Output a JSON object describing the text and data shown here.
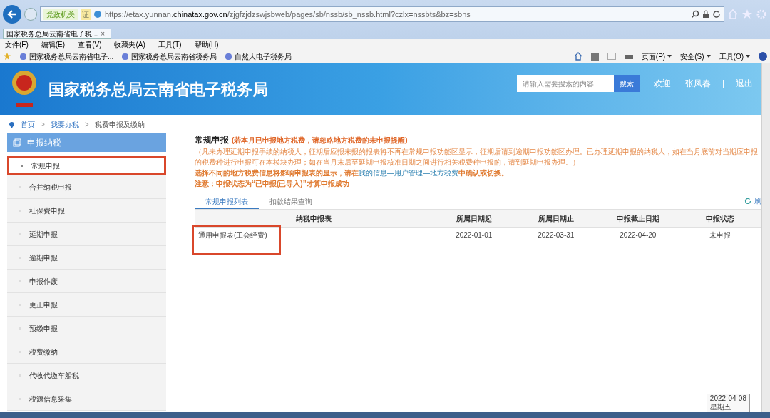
{
  "browser": {
    "address_badge": "党政机关",
    "address_badge_mark": "证",
    "url_host_pre": "https://etax.yunnan.",
    "url_host": "chinatax.gov.cn",
    "url_path": "/zjgfzjdzswjsbweb/pages/sb/nssb/sb_nssb.html?czlx=nssbts&bz=sbns",
    "tab": {
      "title": "国家税务总局云南省电子税...",
      "close": "×"
    },
    "menu": [
      "文件(F)",
      "编辑(E)",
      "查看(V)",
      "收藏夹(A)",
      "工具(T)",
      "帮助(H)"
    ],
    "favorites": [
      "国家税务总局云南省电子...",
      "国家税务总局云南省税务局",
      "自然人电子税务局"
    ],
    "commands": [
      "页面(P)",
      "安全(S)",
      "工具(O)"
    ]
  },
  "header": {
    "site_title": "国家税务总局云南省电子税务局",
    "search": {
      "placeholder": "请输入需要搜索的内容",
      "button": "搜索"
    },
    "welcome": "欢迎",
    "user": "张凤春",
    "separator": "|",
    "logout": "退出"
  },
  "breadcrumb": [
    "首页",
    "我要办税",
    "税费申报及缴纳"
  ],
  "breadcrumb_separator": ">",
  "sidebar": {
    "title": "申报纳税",
    "items": [
      {
        "label": "常规申报",
        "selected": true
      },
      {
        "label": "合并纳税申报",
        "selected": false
      },
      {
        "label": "社保费申报",
        "selected": false
      },
      {
        "label": "延期申报",
        "selected": false
      },
      {
        "label": "逾期申报",
        "selected": false
      },
      {
        "label": "申报作废",
        "selected": false
      },
      {
        "label": "更正申报",
        "selected": false
      },
      {
        "label": "预缴申报",
        "selected": false
      },
      {
        "label": "税费缴纳",
        "selected": false
      },
      {
        "label": "代收代缴车船税",
        "selected": false
      },
      {
        "label": "税源信息采集",
        "selected": false
      }
    ]
  },
  "content": {
    "title": "常规申报",
    "title_note": "(若本月已申报地方税费，请忽略地方税费的未申报提醒)",
    "notice": "（凡未办理延期申报手续的纳税人，征期后应报未报的报表将不再在常规申报功能区显示，征期后请到逾期申报功能区办理。已办理延期申报的纳税人，如在当月底前对当期应申报的税费种进行申报可在本模块办理；如在当月末后至延期申报核准日期之间进行相关税费种申报的，请到延期申报办理。）",
    "hint": {
      "before": "选择不同的地方税费信息将影响申报表的显示，请在",
      "link": "我的信息—用户管理—地方税费",
      "after": "中确认或切换。"
    },
    "warning": "注意：申报状态为“已申报(已导入)”才算申报成功",
    "tabs": [
      {
        "label": "常规申报列表",
        "selected": true
      },
      {
        "label": "扣款结果查询",
        "selected": false
      }
    ],
    "refresh": "刷",
    "table": {
      "columns": [
        "纳税申报表",
        "所属日期起",
        "所属日期止",
        "申报截止日期",
        "申报状态"
      ],
      "rows": [
        {
          "cells": [
            "通用申报表(工会经费)",
            "2022-01-01",
            "2022-03-31",
            "2022-04-20",
            "未申报"
          ],
          "highlighted": true
        }
      ]
    }
  },
  "clock": {
    "date": "2022-04-08",
    "weekday": "星期五"
  }
}
